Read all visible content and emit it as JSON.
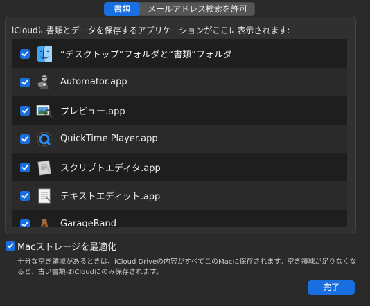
{
  "tabs": [
    {
      "label": "書類",
      "active": true
    },
    {
      "label": "メールアドレス検索を許可",
      "active": false
    }
  ],
  "group_title": "iCloudに書類とデータを保存するアプリケーションがここに表示されます:",
  "apps": [
    {
      "label": "“デスクトップ”フォルダと“書類”フォルダ",
      "checked": true,
      "icon": "finder-icon"
    },
    {
      "label": "Automator.app",
      "checked": true,
      "icon": "automator-icon"
    },
    {
      "label": "プレビュー.app",
      "checked": true,
      "icon": "preview-icon"
    },
    {
      "label": "QuickTime Player.app",
      "checked": true,
      "icon": "quicktime-icon"
    },
    {
      "label": "スクリプトエディタ.app",
      "checked": true,
      "icon": "script-editor-icon"
    },
    {
      "label": "テキストエディット.app",
      "checked": true,
      "icon": "textedit-icon"
    },
    {
      "label": "GarageBand",
      "checked": true,
      "icon": "garageband-icon"
    }
  ],
  "optimize": {
    "label": "Macストレージを最適化",
    "checked": true,
    "description": "十分な空き領域があるときは、iCloud Driveの内容がすべてこのMacに保存されます。空き領域が足りなくなると、古い書類はiCloudにのみ保存されます。"
  },
  "done_label": "完了",
  "colors": {
    "accent": "#1a6fe0",
    "background": "#2a2a2a",
    "list": "#1e1e1e"
  }
}
